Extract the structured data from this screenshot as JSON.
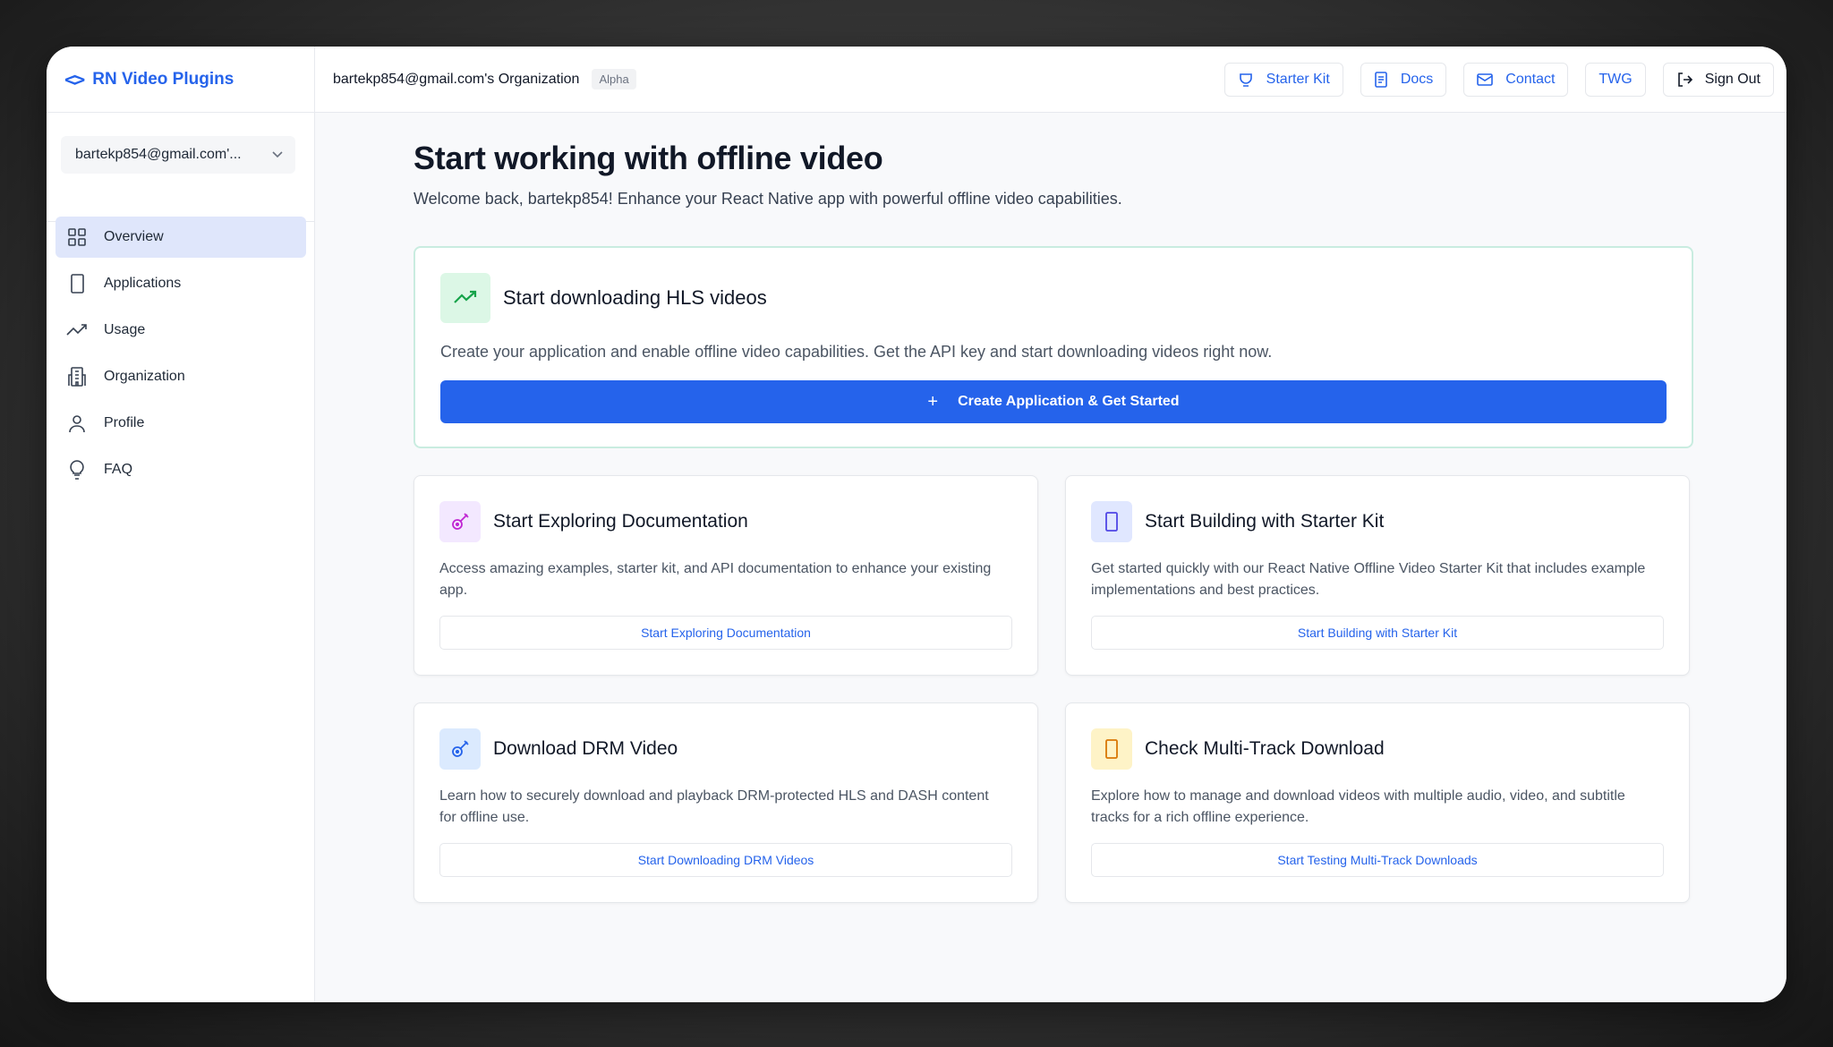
{
  "sidebar": {
    "brand": "RN Video Plugins",
    "org_select": "bartekp854@gmail.com'...",
    "items": [
      {
        "label": "Overview"
      },
      {
        "label": "Applications"
      },
      {
        "label": "Usage"
      },
      {
        "label": "Organization"
      },
      {
        "label": "Profile"
      },
      {
        "label": "FAQ"
      }
    ]
  },
  "header": {
    "org_title": "bartekp854@gmail.com's Organization",
    "badge": "Alpha",
    "actions": [
      {
        "label": "Starter Kit",
        "icon": "cup-icon"
      },
      {
        "label": "Docs",
        "icon": "document-icon"
      },
      {
        "label": "Contact",
        "icon": "mail-icon"
      },
      {
        "label": "TWG",
        "icon": ""
      },
      {
        "label": "Sign Out",
        "icon": "sign-out-icon"
      }
    ]
  },
  "main": {
    "title": "Start working with offline video",
    "subtitle": "Welcome back, bartekp854! Enhance your React Native app with powerful offline video capabilities.",
    "hero": {
      "title": "Start downloading HLS videos",
      "description": "Create your application and enable offline video capabilities. Get the API key and start downloading videos right now.",
      "button": "Create Application & Get Started"
    },
    "cards": [
      {
        "title": "Start Exploring Documentation",
        "description": "Access amazing examples, starter kit, and API documentation to enhance your existing app.",
        "button": "Start Exploring Documentation",
        "icon": "guitar-icon",
        "color": "#f3e8ff"
      },
      {
        "title": "Start Building with Starter Kit",
        "description": "Get started quickly with our React Native Offline Video Starter Kit that includes example implementations and best practices.",
        "button": "Start Building with Starter Kit",
        "icon": "tablet-icon",
        "color": "#e0e7ff"
      },
      {
        "title": "Download DRM Video",
        "description": "Learn how to securely download and playback DRM-protected HLS and DASH content for offline use.",
        "button": "Start Downloading DRM Videos",
        "icon": "guitar-icon",
        "color": "#dbeafe"
      },
      {
        "title": "Check Multi-Track Download",
        "description": "Explore how to manage and download videos with multiple audio, video, and subtitle tracks for a rich offline experience.",
        "button": "Start Testing Multi-Track Downloads",
        "icon": "tablet-icon",
        "color": "#fef3c7"
      }
    ]
  },
  "colors": {
    "accent": "#2563eb",
    "hero_border": "#c9ece0",
    "active_nav": "#dfe6fb"
  }
}
